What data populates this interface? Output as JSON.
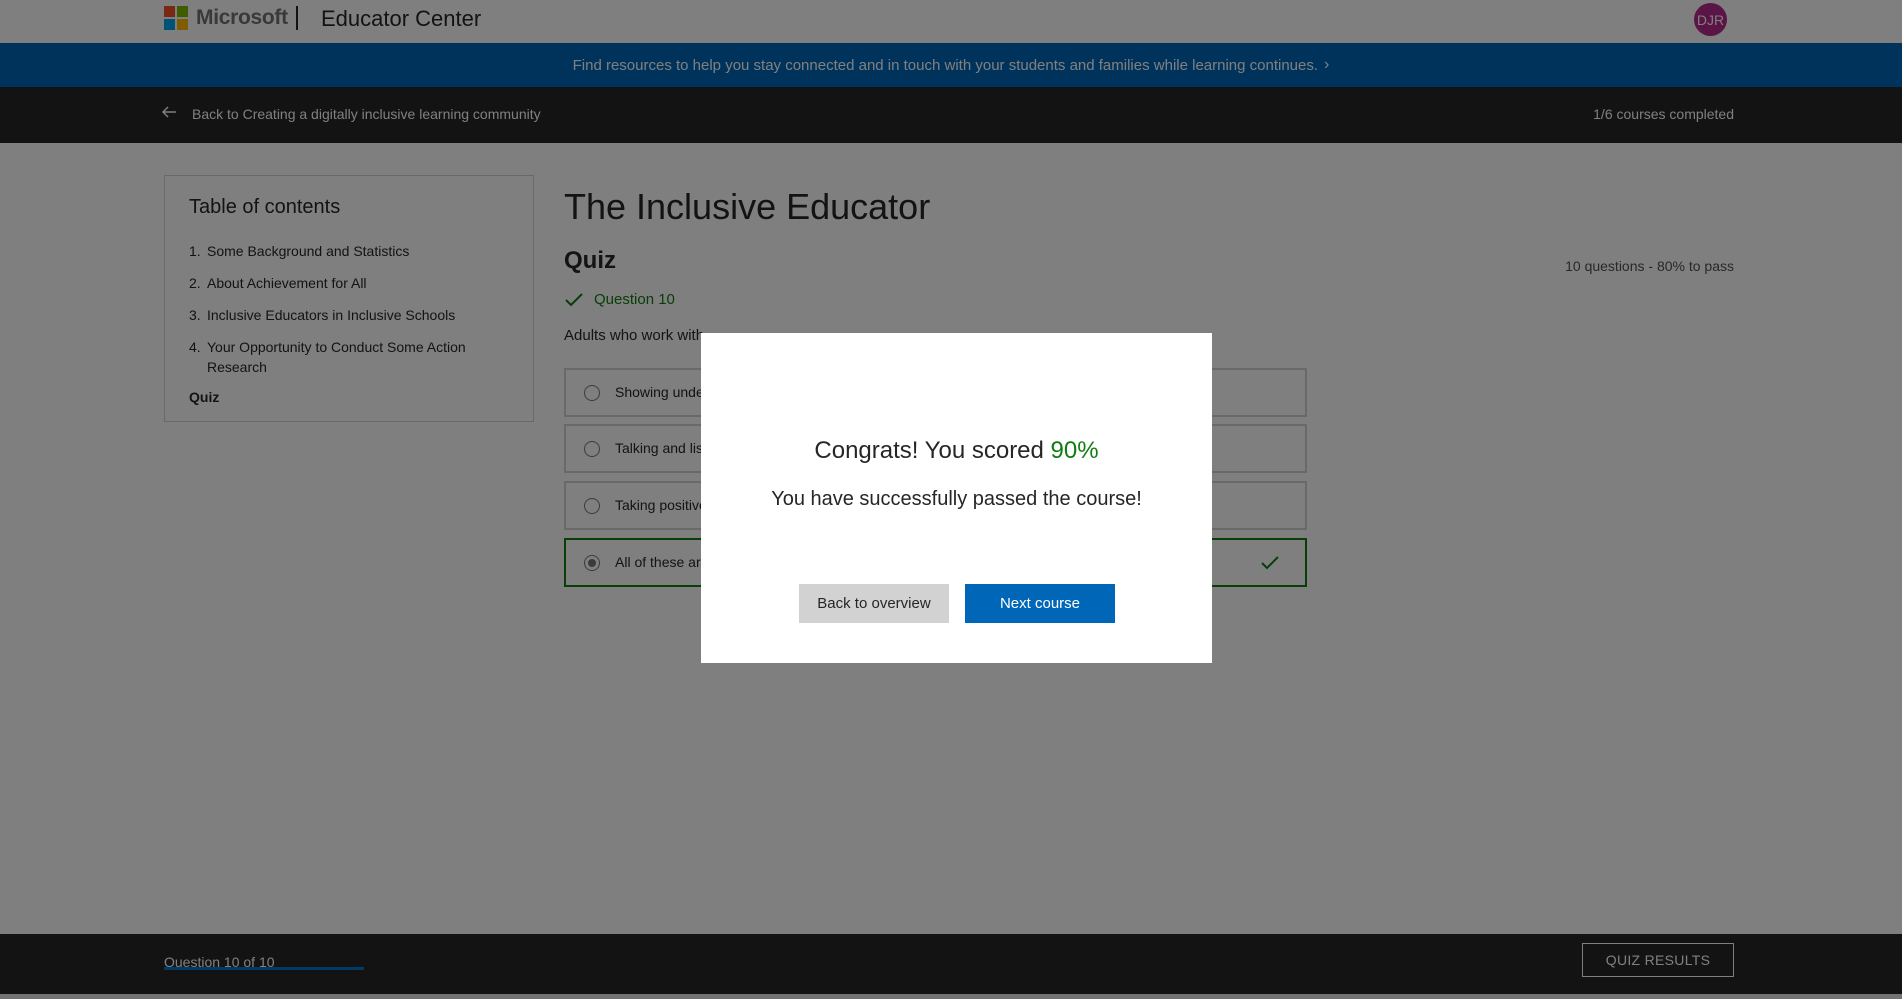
{
  "header": {
    "brand": "Microsoft",
    "title": "Educator Center",
    "avatar_initials": "DJR",
    "logo_colors": [
      "#f25022",
      "#7fba00",
      "#00a4ef",
      "#ffb900"
    ]
  },
  "banner": {
    "text": "Find resources to help you stay connected and in touch with your students and families while learning continues.",
    "chevron": "›"
  },
  "breadcrumb": {
    "back_label": "Back to Creating a digitally inclusive learning community",
    "progress": "1/6 courses completed"
  },
  "toc": {
    "title": "Table of contents",
    "items": [
      {
        "num": "1.",
        "label": "Some Background and Statistics"
      },
      {
        "num": "2.",
        "label": "About Achievement for All"
      },
      {
        "num": "3.",
        "label": "Inclusive Educators in Inclusive Schools"
      },
      {
        "num": "4.",
        "label": "Your Opportunity to Conduct Some Action Research"
      }
    ],
    "current": "Quiz"
  },
  "main": {
    "course_title": "The Inclusive Educator",
    "quiz_heading": "Quiz",
    "quiz_meta": "10 questions - 80% to pass",
    "question_label": "Question 10",
    "question_text": "Adults who work with",
    "options": [
      {
        "text": "Showing unde",
        "selected": false,
        "correct": false
      },
      {
        "text": "Talking and list",
        "selected": false,
        "correct": false
      },
      {
        "text": "Taking positive",
        "selected": false,
        "correct": false
      },
      {
        "text": "All of these are",
        "selected": true,
        "correct": true
      }
    ]
  },
  "modal": {
    "title_prefix": "Congrats! You scored ",
    "score": "90%",
    "subtitle": "You have successfully passed the course!",
    "back_button": "Back to overview",
    "next_button": "Next course"
  },
  "footer": {
    "question_progress": "Question 10 of 10",
    "progress_fraction": 1.0,
    "results_button": "QUIZ RESULTS"
  },
  "colors": {
    "accent": "#0067b8",
    "success": "#107c10",
    "dark_bar": "#262626",
    "avatar": "#b4288c"
  }
}
